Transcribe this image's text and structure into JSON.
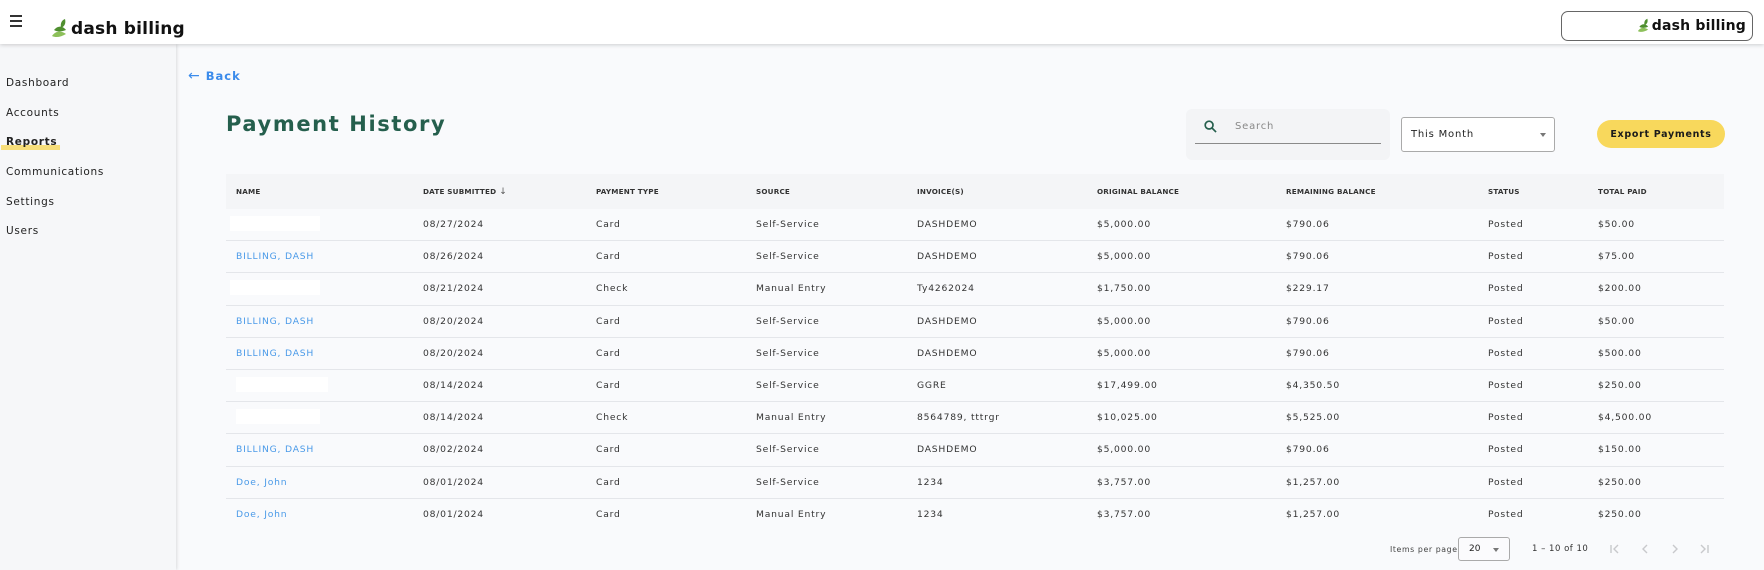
{
  "header": {
    "logo_text": "dash billing",
    "right_logo_text": "dash billing",
    "menu_icon": "hamburger-menu-icon",
    "brand_colors": {
      "leaf_dark": "#4f8f2f",
      "leaf_light": "#8dc05a"
    }
  },
  "sidebar": {
    "items": [
      {
        "label": "Dashboard",
        "active": false
      },
      {
        "label": "Accounts",
        "active": false
      },
      {
        "label": "Reports",
        "active": true
      },
      {
        "label": "Communications",
        "active": false
      },
      {
        "label": "Settings",
        "active": false
      },
      {
        "label": "Users",
        "active": false
      }
    ],
    "active_highlight_color": "#f7de7a"
  },
  "main": {
    "back_label": "Back",
    "title": "Payment History",
    "title_color": "#255f4d",
    "search": {
      "placeholder": "Search",
      "value": ""
    },
    "period_select": {
      "value": "This Month"
    },
    "export_label": "Export Payments",
    "export_color": "#f8d85c"
  },
  "table": {
    "columns": [
      "NAME",
      "DATE SUBMITTED",
      "PAYMENT TYPE",
      "SOURCE",
      "INVOICE(S)",
      "ORIGINAL BALANCE",
      "REMAINING BALANCE",
      "STATUS",
      "TOTAL PAID"
    ],
    "sort": {
      "column": "DATE SUBMITTED",
      "direction": "desc"
    },
    "rows": [
      {
        "name": "",
        "date": "08/27/2024",
        "type": "Card",
        "source": "Self-Service",
        "invoices": "DASHDEMO",
        "original": "$5,000.00",
        "remaining": "$790.06",
        "status": "Posted",
        "paid": "$50.00"
      },
      {
        "name": "BILLING, DASH",
        "date": "08/26/2024",
        "type": "Card",
        "source": "Self-Service",
        "invoices": "DASHDEMO",
        "original": "$5,000.00",
        "remaining": "$790.06",
        "status": "Posted",
        "paid": "$75.00"
      },
      {
        "name": "",
        "date": "08/21/2024",
        "type": "Check",
        "source": "Manual Entry",
        "invoices": "Ty4262024",
        "original": "$1,750.00",
        "remaining": "$229.17",
        "status": "Posted",
        "paid": "$200.00"
      },
      {
        "name": "BILLING, DASH",
        "date": "08/20/2024",
        "type": "Card",
        "source": "Self-Service",
        "invoices": "DASHDEMO",
        "original": "$5,000.00",
        "remaining": "$790.06",
        "status": "Posted",
        "paid": "$50.00"
      },
      {
        "name": "BILLING, DASH",
        "date": "08/20/2024",
        "type": "Card",
        "source": "Self-Service",
        "invoices": "DASHDEMO",
        "original": "$5,000.00",
        "remaining": "$790.06",
        "status": "Posted",
        "paid": "$500.00"
      },
      {
        "name": "",
        "date": "08/14/2024",
        "type": "Card",
        "source": "Self-Service",
        "invoices": "GGRE",
        "original": "$17,499.00",
        "remaining": "$4,350.50",
        "status": "Posted",
        "paid": "$250.00"
      },
      {
        "name": "",
        "date": "08/14/2024",
        "type": "Check",
        "source": "Manual Entry",
        "invoices": "8564789, tttrgr",
        "original": "$10,025.00",
        "remaining": "$5,525.00",
        "status": "Posted",
        "paid": "$4,500.00"
      },
      {
        "name": "BILLING, DASH",
        "date": "08/02/2024",
        "type": "Card",
        "source": "Self-Service",
        "invoices": "DASHDEMO",
        "original": "$5,000.00",
        "remaining": "$790.06",
        "status": "Posted",
        "paid": "$150.00"
      },
      {
        "name": "Doe, John",
        "date": "08/01/2024",
        "type": "Card",
        "source": "Self-Service",
        "invoices": "1234",
        "original": "$3,757.00",
        "remaining": "$1,257.00",
        "status": "Posted",
        "paid": "$250.00"
      },
      {
        "name": "Doe, John",
        "date": "08/01/2024",
        "type": "Card",
        "source": "Manual Entry",
        "invoices": "1234",
        "original": "$3,757.00",
        "remaining": "$1,257.00",
        "status": "Posted",
        "paid": "$250.00"
      }
    ]
  },
  "pagination": {
    "items_per_page_label": "Items per page:",
    "items_per_page": "20",
    "range_label": "1 – 10 of 10",
    "first_icon": "first-page-icon",
    "prev_icon": "chevron-left-icon",
    "next_icon": "chevron-right-icon",
    "last_icon": "last-page-icon"
  }
}
